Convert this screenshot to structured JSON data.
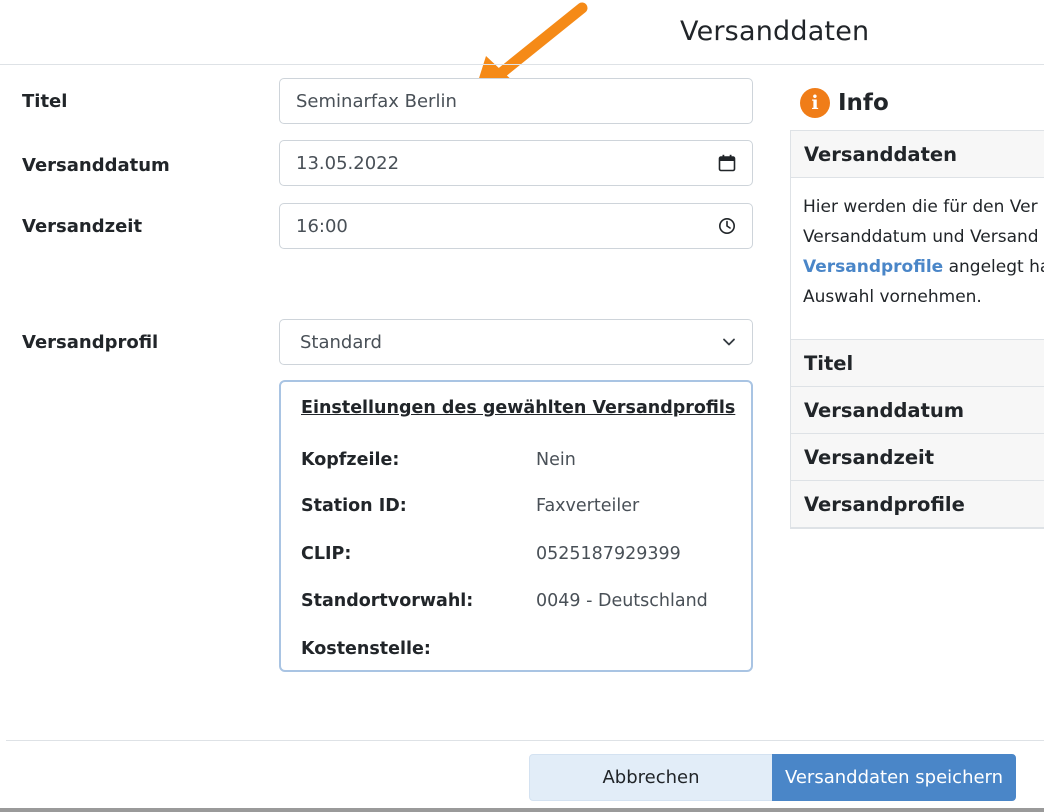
{
  "modal": {
    "title": "Versanddaten"
  },
  "form": {
    "title_label": "Titel",
    "title_value": "Seminarfax Berlin",
    "date_label": "Versanddatum",
    "date_value": "13.05.2022",
    "time_label": "Versandzeit",
    "time_value": "16:00",
    "profile_label": "Versandprofil",
    "profile_value": "Standard"
  },
  "profile_settings": {
    "heading": "Einstellungen des gewählten Versandprofils",
    "rows": [
      {
        "label": "Kopfzeile:",
        "value": "Nein"
      },
      {
        "label": "Station ID:",
        "value": "Faxverteiler"
      },
      {
        "label": "CLIP:",
        "value": "0525187929399"
      },
      {
        "label": "Standortvorwahl:",
        "value": "0049 - Deutschland"
      },
      {
        "label": "Kostenstelle:",
        "value": ""
      }
    ]
  },
  "info": {
    "title": "Info",
    "sections": [
      {
        "label": "Versanddaten"
      },
      {
        "label": "Titel"
      },
      {
        "label": "Versanddatum"
      },
      {
        "label": "Versandzeit"
      },
      {
        "label": "Versandprofile"
      }
    ],
    "body": {
      "line1": "Hier werden die für den Ver",
      "line2": "Versanddatum und Versand",
      "line3_link": "Versandprofile",
      "line3_rest": " angelegt ha",
      "line4": "Auswahl vornehmen."
    }
  },
  "footer": {
    "cancel_label": "Abbrechen",
    "save_label": "Versanddaten speichern"
  },
  "colors": {
    "primary": "#4a86c8",
    "info_icon": "#f07d18",
    "arrow": "#f58a17"
  }
}
